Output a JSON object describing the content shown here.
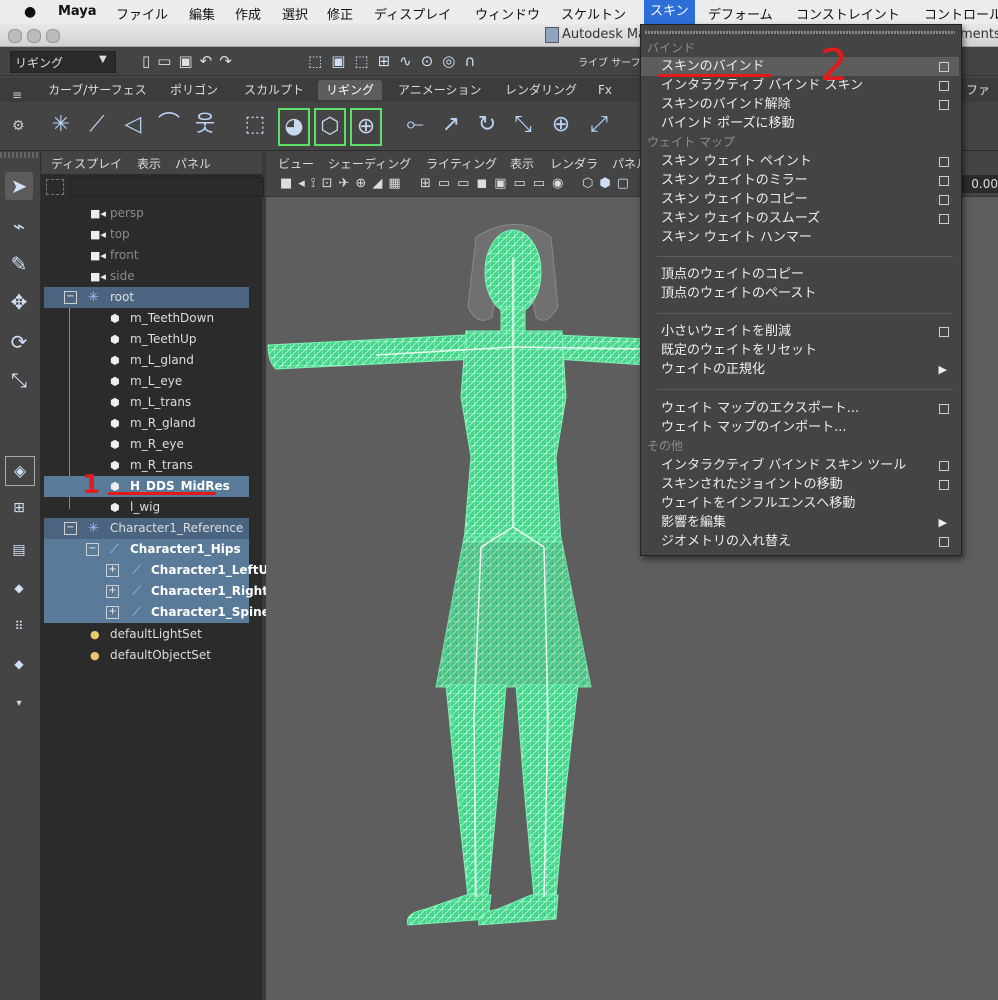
{
  "macmenu": {
    "apple": "",
    "app": "Maya",
    "items": [
      "ファイル",
      "編集",
      "作成",
      "選択",
      "修正",
      "ディスプレイ",
      "ウィンドウ",
      "スケルトン",
      "スキン",
      "デフォーム",
      "コンストレイント",
      "コントロール"
    ]
  },
  "titlebar": {
    "title": "Autodesk Ma",
    "title_right": "ments/b"
  },
  "statusline": {
    "mode": "リギング",
    "live_label": "ライブ",
    "live_sub": "サーフェスな"
  },
  "shelf_tabs": [
    "カーブ/サーフェス",
    "ポリゴン",
    "スカルプト",
    "リギング",
    "アニメーション",
    "レンダリング",
    "Fx",
    "ファー"
  ],
  "outliner": {
    "menu": [
      "ディスプレイ",
      "表示",
      "パネル"
    ],
    "rows": [
      {
        "label": "persp"
      },
      {
        "label": "top"
      },
      {
        "label": "front"
      },
      {
        "label": "side"
      },
      {
        "label": "root"
      },
      {
        "label": "m_TeethDown"
      },
      {
        "label": "m_TeethUp"
      },
      {
        "label": "m_L_gland"
      },
      {
        "label": "m_L_eye"
      },
      {
        "label": "m_L_trans"
      },
      {
        "label": "m_R_gland"
      },
      {
        "label": "m_R_eye"
      },
      {
        "label": "m_R_trans"
      },
      {
        "label": "H_DDS_MidRes"
      },
      {
        "label": "l_wig"
      },
      {
        "label": "Character1_Reference"
      },
      {
        "label": "Character1_Hips"
      },
      {
        "label": "Character1_LeftU"
      },
      {
        "label": "Character1_Right"
      },
      {
        "label": "Character1_Spine"
      },
      {
        "label": "defaultLightSet"
      },
      {
        "label": "defaultObjectSet"
      }
    ]
  },
  "viewport": {
    "menu": [
      "ビュー",
      "シェーディング",
      "ライティング",
      "表示",
      "レンダラ",
      "パネル"
    ],
    "field_value": "0.00"
  },
  "skin_menu": {
    "sections": [
      "バインド",
      "ウェイト マップ",
      "その他"
    ],
    "items": [
      {
        "label": "スキンのバインド",
        "option": true
      },
      {
        "label": "インタラクティブ バインド スキン",
        "option": true
      },
      {
        "label": "スキンのバインド解除",
        "option": true
      },
      {
        "label": "バインド ポーズに移動",
        "option": false
      },
      {
        "label": "スキン ウェイト ペイント",
        "option": true
      },
      {
        "label": "スキン ウェイトのミラー",
        "option": true
      },
      {
        "label": "スキン ウェイトのコピー",
        "option": true
      },
      {
        "label": "スキン ウェイトのスムーズ",
        "option": true
      },
      {
        "label": "スキン ウェイト ハンマー",
        "option": false
      },
      {
        "label": "頂点のウェイトのコピー",
        "option": false
      },
      {
        "label": "頂点のウェイトのペースト",
        "option": false
      },
      {
        "label": "小さいウェイトを削減",
        "option": true
      },
      {
        "label": "既定のウェイトをリセット",
        "option": false
      },
      {
        "label": "ウェイトの正規化",
        "submenu": true
      },
      {
        "label": "ウェイト マップのエクスポート...",
        "option": true
      },
      {
        "label": "ウェイト マップのインポート...",
        "option": false
      },
      {
        "label": "インタラクティブ バインド スキン ツール",
        "option": true
      },
      {
        "label": "スキンされたジョイントの移動",
        "option": true
      },
      {
        "label": "ウェイトをインフルエンスへ移動",
        "option": false
      },
      {
        "label": "影響を編集",
        "submenu": true
      },
      {
        "label": "ジオメトリの入れ替え",
        "option": true
      }
    ]
  },
  "annotations": {
    "one": "1",
    "two": "2"
  },
  "colors": {
    "selection": "#5a7a9a",
    "wireframe": "#5cf0a2",
    "annotation": "#e31a1a",
    "menubar_active": "#2c6fd8"
  }
}
